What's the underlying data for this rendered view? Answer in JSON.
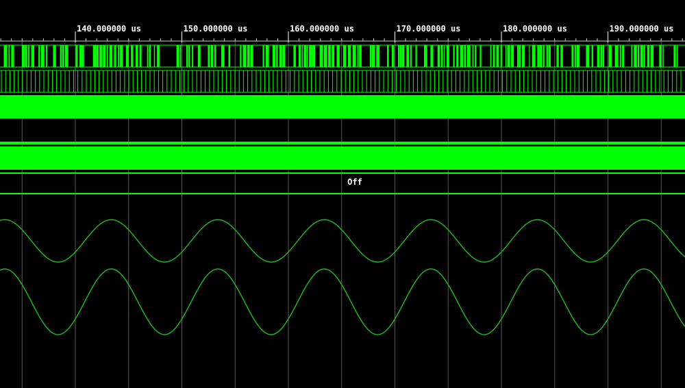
{
  "timeline": {
    "unit": "us",
    "ticks": [
      {
        "label": "140.000000 us"
      },
      {
        "label": "150.000000 us"
      },
      {
        "label": "160.000000 us"
      },
      {
        "label": "170.000000 us"
      },
      {
        "label": "180.000000 us"
      },
      {
        "label": "190.000000 us"
      }
    ]
  },
  "traces": [
    {
      "kind": "dense-digital"
    },
    {
      "kind": "clock"
    },
    {
      "kind": "solid-bus"
    },
    {
      "kind": "blank"
    },
    {
      "kind": "solid-bus"
    },
    {
      "kind": "bus",
      "value": "Off"
    },
    {
      "kind": "analog-sine"
    },
    {
      "kind": "analog-sine"
    }
  ],
  "colors": {
    "background": "#000000",
    "trace": "#00ff00",
    "analog": "#1fb41f",
    "grid": "#5a5a5a",
    "text": "#ffffff"
  }
}
